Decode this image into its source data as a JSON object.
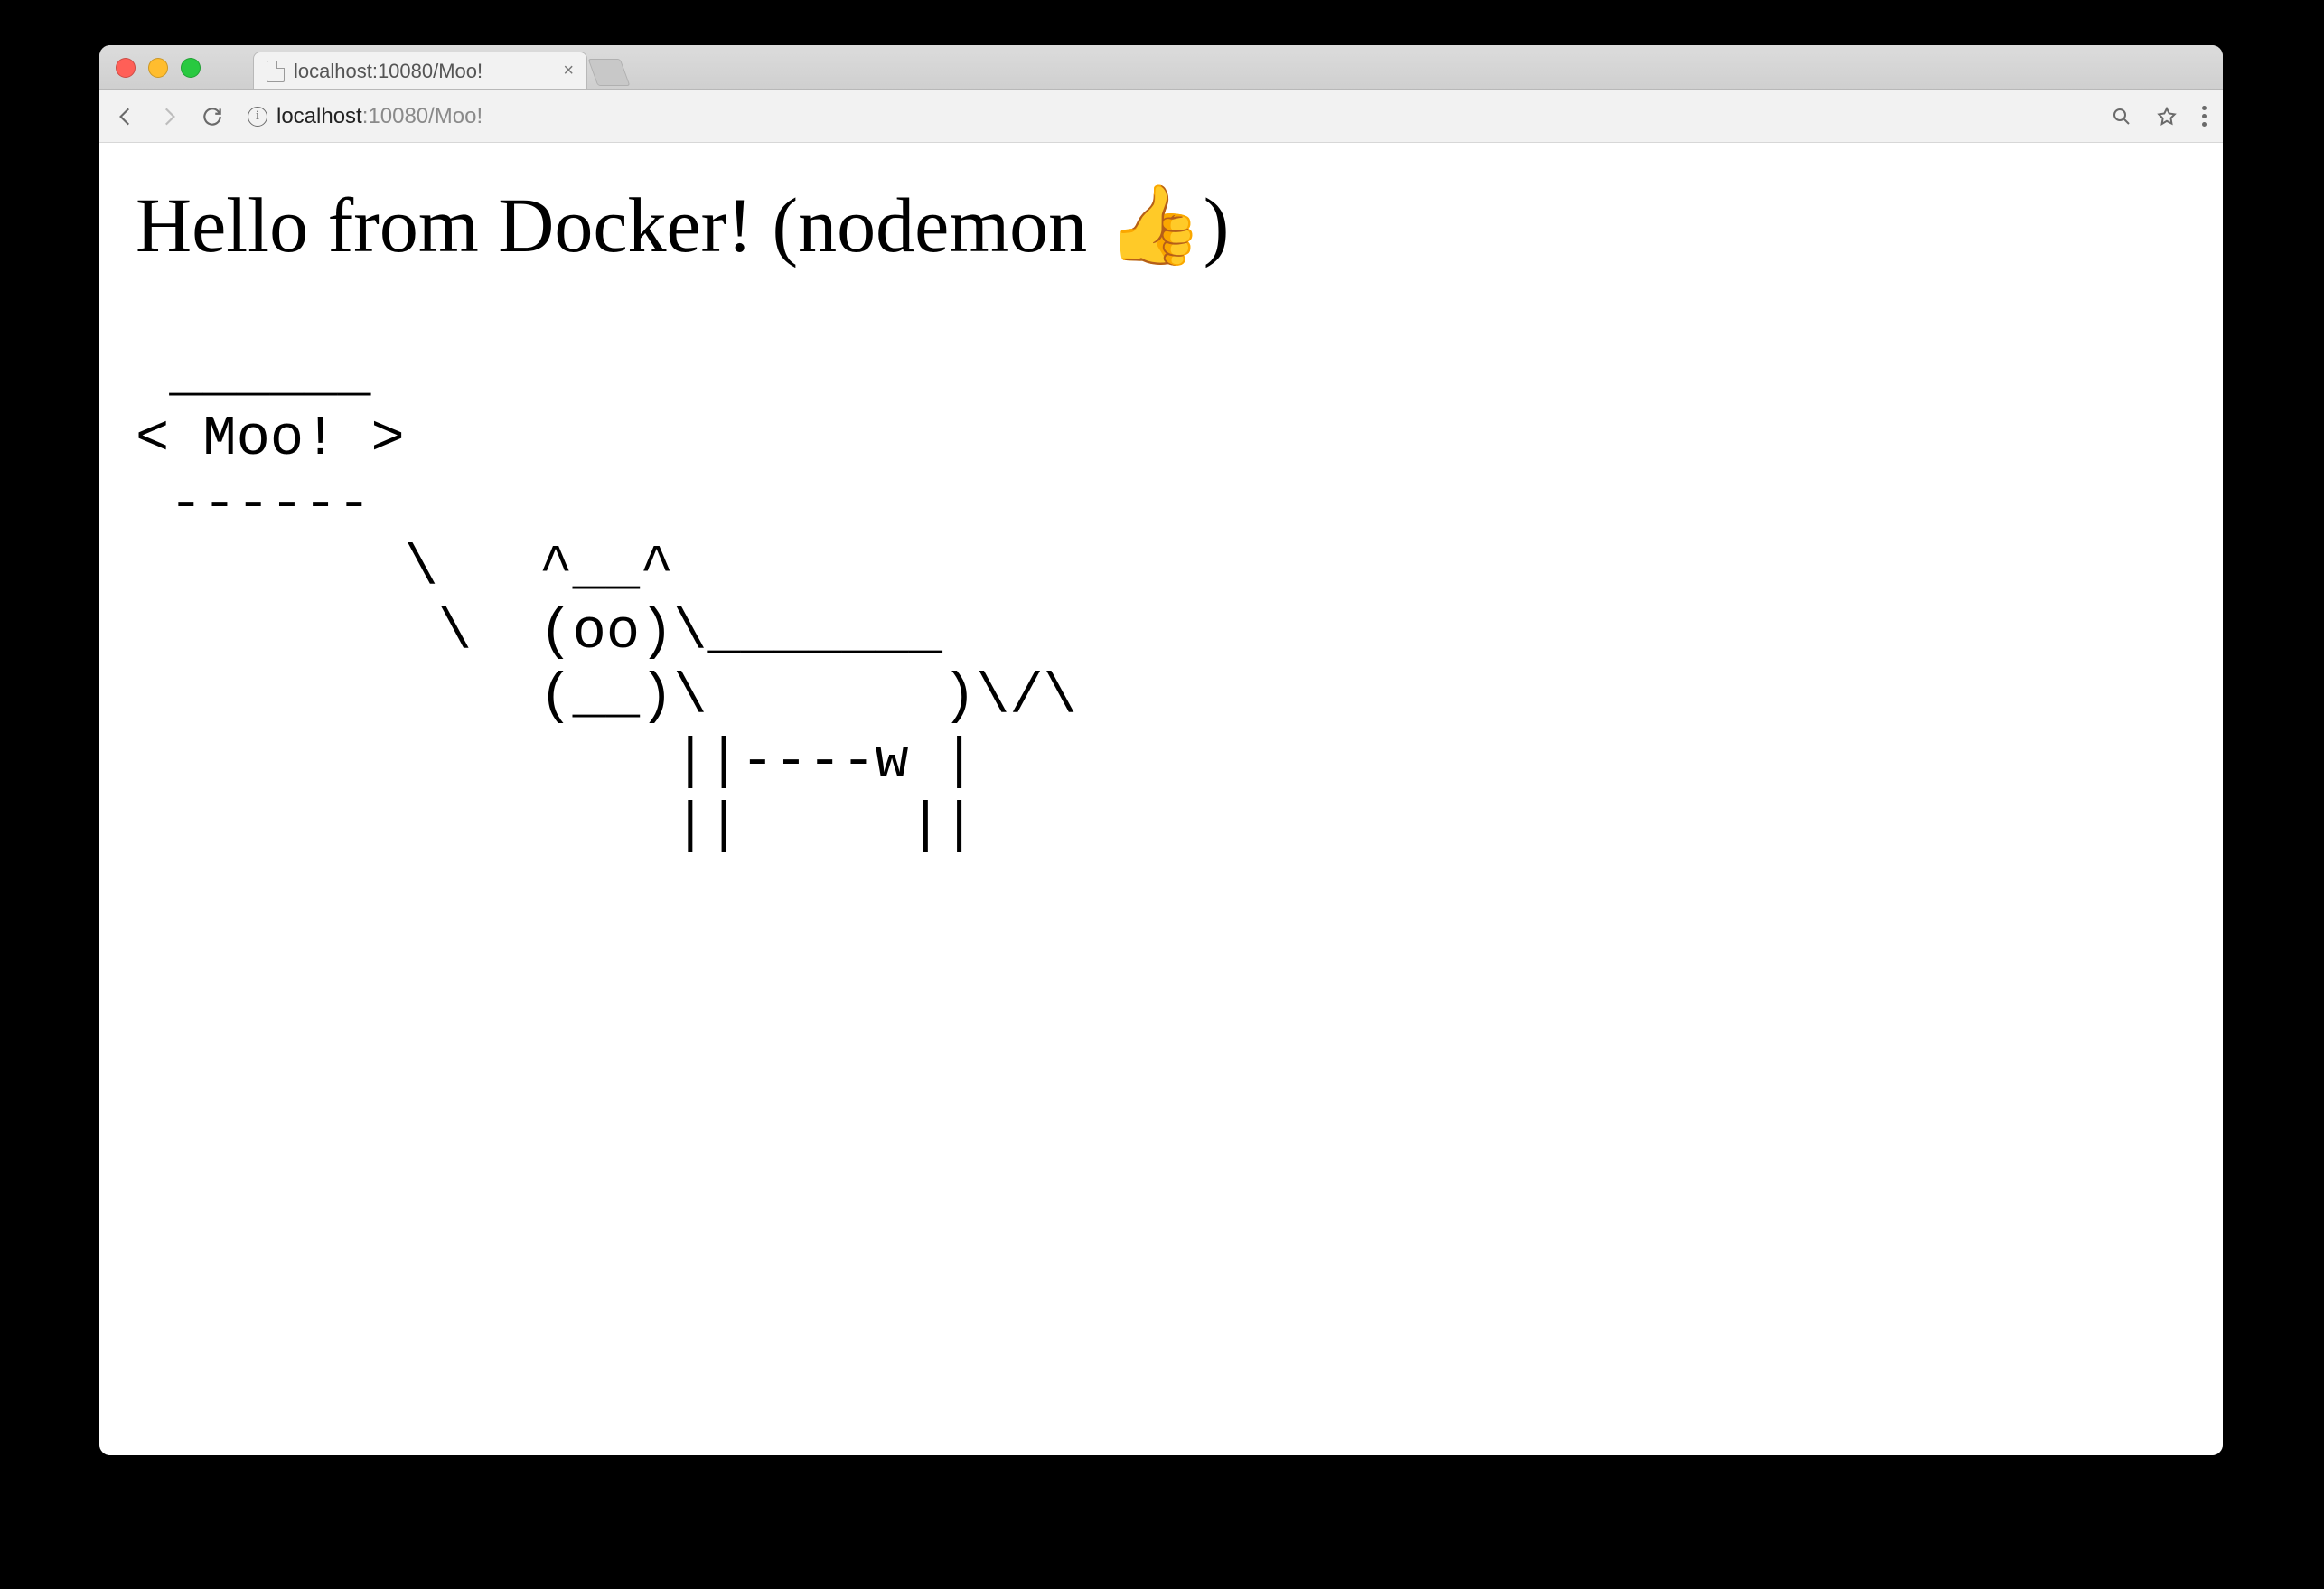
{
  "browser": {
    "tab_title": "localhost:10080/Moo!",
    "url_host": "localhost",
    "url_rest": ":10080/Moo!",
    "info_glyph": "i",
    "apple_glyph": ""
  },
  "page": {
    "heading": "Hello from Docker! (nodemon 👍)",
    "cowsay": " ______\n< Moo! >\n ------\n        \\   ^__^\n         \\  (oo)\\_______\n            (__)\\       )\\/\\\n                ||----w |\n                ||     ||"
  }
}
